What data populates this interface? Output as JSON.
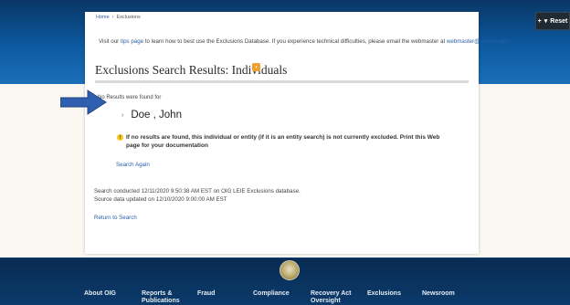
{
  "reset_button": {
    "label": "Reset",
    "icons": [
      "plus-icon",
      "chevron-down-icon"
    ]
  },
  "breadcrumb": {
    "home": "Home",
    "current": "Exclusions"
  },
  "tips": {
    "prefix": "Visit our ",
    "link": "tips page",
    "middle": " to learn how to best use the Exclusions Database. If you experience technical difficulties, please email the webmaster at ",
    "email": "webmaster@oig.hhs.gov",
    "suffix": "."
  },
  "heading": "Exclusions Search Results: Individuals",
  "no_results_label": "No Results were found for",
  "searched_name": "Doe , John",
  "warning": "If no results are found, this individual or entity (if it is an entity search) is not currently excluded. Print this Web page for your documentation",
  "search_again": "Search Again",
  "search_conducted": "Search conducted 12/11/2020 9:50:38 AM EST on OIG LEIE Exclusions database.",
  "source_updated": "Source data updated on 12/10/2020 9:00:00 AM EST",
  "return_link": "Return to Search",
  "footer_nav": [
    {
      "label": "About OIG"
    },
    {
      "label": "Reports &\nPublications"
    },
    {
      "label": "Fraud"
    },
    {
      "label": "Compliance"
    },
    {
      "label": "Recovery Act\nOversight"
    },
    {
      "label": "Exclusions"
    },
    {
      "label": "Newsroom"
    }
  ],
  "colors": {
    "header_blue": "#0d5aa0",
    "link_blue": "#2a5fa5",
    "arrow_blue": "#2f5fae",
    "footer_navy": "#0b3a6b"
  }
}
